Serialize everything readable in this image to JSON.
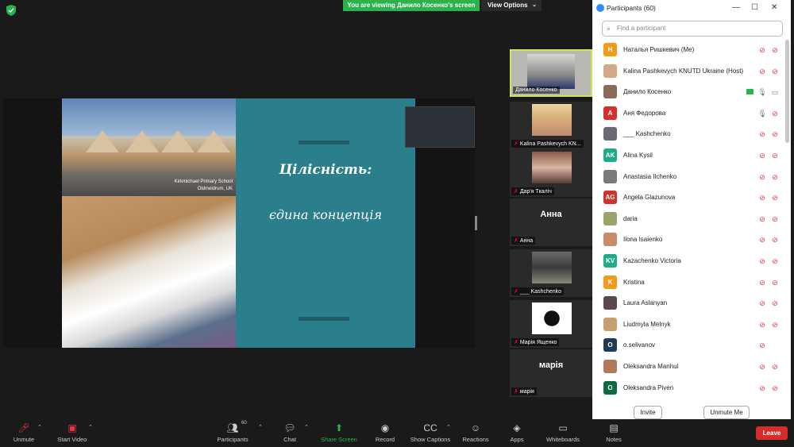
{
  "banner": {
    "text": "You are viewing Данило Косенко's screen",
    "view_options": "View Options"
  },
  "slide": {
    "title": "Цілісність:",
    "subtitle": "єдина концепція",
    "caption_line1": "Kirkmichael Primary School",
    "caption_line2": "Oldmeldrum, UK"
  },
  "gallery": [
    {
      "name": "Данило Косенко"
    },
    {
      "name": "Kalina Pashkevych KN..."
    },
    {
      "name": "Дар'я Ткаліч"
    },
    {
      "name": "Анна",
      "big": "Анна"
    },
    {
      "name": "___ Kashchenko"
    },
    {
      "name": "Марія Ященко"
    },
    {
      "name": "марія",
      "big": "марія"
    }
  ],
  "panel": {
    "title": "Participants (60)",
    "search_placeholder": "Find a participant",
    "participants": [
      {
        "name": "Наталья Ришкевич (Me)",
        "initials": "Н",
        "color": "#f29a19"
      },
      {
        "name": "Kalina Pashkevych KNUTD Ukraine (Host)",
        "initials": "",
        "color": "#d4a98a"
      },
      {
        "name": "Данило Косенко",
        "initials": "",
        "color": "#8a6a5a"
      },
      {
        "name": "Аня Федорова",
        "initials": "А",
        "color": "#d2322d"
      },
      {
        "name": "___ Kashchenko",
        "initials": "",
        "color": "#6a6a72"
      },
      {
        "name": "Alina Kysil",
        "initials": "AK",
        "color": "#1fab89"
      },
      {
        "name": "Anastasia Ilchenko",
        "initials": "",
        "color": "#7a7a7a"
      },
      {
        "name": "Angela Glazunova",
        "initials": "AG",
        "color": "#d2322d"
      },
      {
        "name": "daria",
        "initials": "",
        "color": "#9aa36a"
      },
      {
        "name": "Ilona Isaienko",
        "initials": "",
        "color": "#c88a6a"
      },
      {
        "name": "Kazachenko Victoria",
        "initials": "KV",
        "color": "#1fab89"
      },
      {
        "name": "Kristina",
        "initials": "K",
        "color": "#f29a19"
      },
      {
        "name": "Laura Aslanyan",
        "initials": "",
        "color": "#5a4a4a"
      },
      {
        "name": "Liudmyla Melnyk",
        "initials": "",
        "color": "#c8a070"
      },
      {
        "name": "o.selivanov",
        "initials": "O",
        "color": "#1f3b57"
      },
      {
        "name": "Oleksandra Manhul",
        "initials": "",
        "color": "#b07a5a"
      },
      {
        "name": "Oleksandra Piven",
        "initials": "O",
        "color": "#0f6b3f"
      }
    ],
    "invite": "Invite",
    "unmute_me": "Unmute Me"
  },
  "toolbar": {
    "unmute": "Unmute",
    "start_video": "Start Video",
    "participants": "Participants",
    "participants_count": "60",
    "chat": "Chat",
    "share_screen": "Share Screen",
    "record": "Record",
    "show_captions": "Show Captions",
    "reactions": "Reactions",
    "apps": "Apps",
    "whiteboards": "Whiteboards",
    "notes": "Notes",
    "leave": "Leave"
  },
  "colors": {
    "accent_green": "#2bb24c",
    "slide_teal": "#2b7f8c",
    "leave_red": "#d72c2c",
    "active_border": "#c8e65a"
  }
}
